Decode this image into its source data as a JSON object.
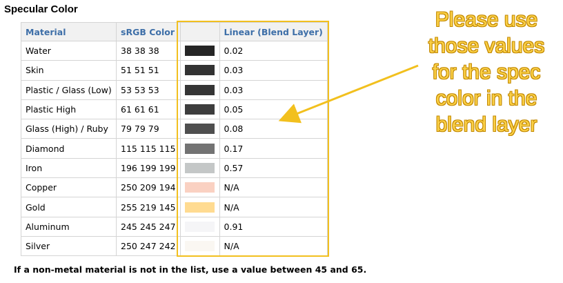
{
  "title": "Specular Color",
  "table": {
    "headers": [
      "Material",
      "sRGB Color",
      "",
      "Linear (Blend Layer)"
    ],
    "rows": [
      {
        "material": "Water",
        "srgb": "38 38 38",
        "swatch": "#262626",
        "linear": "0.02"
      },
      {
        "material": "Skin",
        "srgb": "51 51 51",
        "swatch": "#333333",
        "linear": "0.03"
      },
      {
        "material": "Plastic / Glass (Low)",
        "srgb": "53 53 53",
        "swatch": "#353535",
        "linear": "0.03"
      },
      {
        "material": "Plastic High",
        "srgb": "61 61 61",
        "swatch": "#3d3d3d",
        "linear": "0.05"
      },
      {
        "material": "Glass (High) / Ruby",
        "srgb": "79 79 79",
        "swatch": "#4f4f4f",
        "linear": "0.08"
      },
      {
        "material": "Diamond",
        "srgb": "115 115 115",
        "swatch": "#737373",
        "linear": "0.17"
      },
      {
        "material": "Iron",
        "srgb": "196 199 199",
        "swatch": "#c4c7c7",
        "linear": "0.57"
      },
      {
        "material": "Copper",
        "srgb": "250 209 194",
        "swatch": "#fad1c2",
        "linear": "N/A"
      },
      {
        "material": "Gold",
        "srgb": "255 219 145",
        "swatch": "#ffdb91",
        "linear": "N/A"
      },
      {
        "material": "Aluminum",
        "srgb": "245 245 247",
        "swatch": "#f5f5f7",
        "linear": "0.91"
      },
      {
        "material": "Silver",
        "srgb": "250 247 242",
        "swatch": "#faf7f2",
        "linear": "N/A"
      }
    ]
  },
  "annotation": {
    "lines": [
      "Please use",
      "those values",
      "for the spec",
      "color in the",
      "blend layer"
    ],
    "color": "#fbd046",
    "box_color": "#f2c01e"
  },
  "footnote": "If a non-metal material is not in the list, use a value between 45 and 65."
}
